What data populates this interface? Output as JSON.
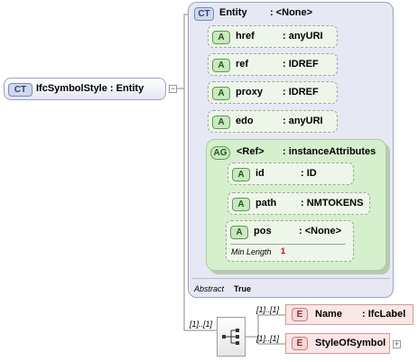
{
  "root": {
    "badge": "CT",
    "label": "IfcSymbolStyle : Entity"
  },
  "base": {
    "badge": "CT",
    "name": "Entity",
    "type": ": <None>",
    "attributes": [
      {
        "badge": "A",
        "name": "href",
        "type": ": anyURI"
      },
      {
        "badge": "A",
        "name": "ref",
        "type": ": IDREF"
      },
      {
        "badge": "A",
        "name": "proxy",
        "type": ": IDREF"
      },
      {
        "badge": "A",
        "name": "edo",
        "type": ": anyURI"
      }
    ],
    "group": {
      "badge": "AG",
      "name": "<Ref>",
      "type": ": instanceAttributes",
      "attributes": [
        {
          "badge": "A",
          "name": "id",
          "type": ": ID"
        },
        {
          "badge": "A",
          "name": "path",
          "type": ": NMTOKENS"
        },
        {
          "badge": "A",
          "name": "pos",
          "type": ": <None>"
        }
      ],
      "min_length_label": "Min Length",
      "min_length_value": "1"
    },
    "abstract_label": "Abstract",
    "abstract_value": "True"
  },
  "sequence": {
    "cardinality": "[1]..[1]",
    "elements": [
      {
        "badge": "E",
        "name": "Name",
        "type": ": IfcLabel",
        "cardinality": "[1]..[1]"
      },
      {
        "badge": "E",
        "name": "StyleOfSymbol",
        "type": "",
        "cardinality": "[1]..[1]"
      }
    ]
  },
  "colors": {
    "complex_type": "#cfd8ee",
    "attribute": "#c9e9c0",
    "element": "#f6d7d7"
  }
}
